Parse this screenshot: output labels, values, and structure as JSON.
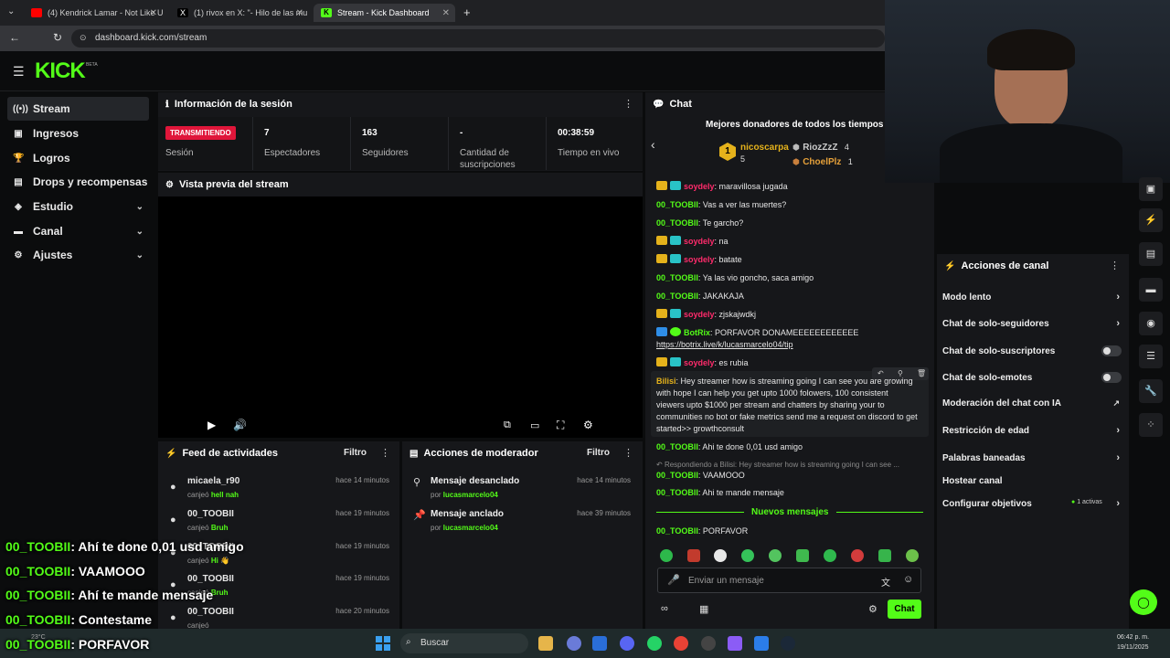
{
  "browser": {
    "tabs": [
      {
        "title": "(4) Kendrick Lamar - Not Like U",
        "active": false
      },
      {
        "title": "(1) rivox en X: \"- Hilo de las mu",
        "active": false
      },
      {
        "title": "Stream - Kick Dashboard",
        "active": true
      }
    ],
    "new_tab_icon": "plus-icon",
    "url": "dashboard.kick.com/stream"
  },
  "kick": {
    "logo": "KICK",
    "beta": "BETA"
  },
  "sidebar": {
    "items": [
      {
        "label": "Stream",
        "icon": "radio-icon"
      },
      {
        "label": "Ingresos",
        "icon": "money-icon"
      },
      {
        "label": "Logros",
        "icon": "trophy-icon"
      },
      {
        "label": "Drops y recompensas",
        "icon": "gift-icon"
      },
      {
        "label": "Estudio",
        "icon": "grid-icon"
      },
      {
        "label": "Canal",
        "icon": "channel-icon"
      },
      {
        "label": "Ajustes",
        "icon": "gear-icon"
      }
    ]
  },
  "session": {
    "title": "Información de la sesión",
    "status": "TRANSMITIENDO",
    "status_label": "Sesión",
    "stats": [
      {
        "value": "7",
        "label": "Espectadores"
      },
      {
        "value": "163",
        "label": "Seguidores"
      },
      {
        "value": "-",
        "label": "Cantidad de suscripciones"
      },
      {
        "value": "00:38:59",
        "label": "Tiempo en vivo"
      }
    ]
  },
  "preview": {
    "title": "Vista previa del stream"
  },
  "activity": {
    "title": "Feed de actividades",
    "filter": "Filtro",
    "rows": [
      {
        "name": "micaela_r90",
        "action": "canjeó",
        "reward": "hell nah",
        "time": "hace 14 minutos"
      },
      {
        "name": "00_TOOBII",
        "action": "canjeó",
        "reward": "Bruh",
        "time": "hace 19 minutos"
      },
      {
        "name": "00_TOOBII",
        "action": "canjeó",
        "reward": "Hi 👋",
        "time": "hace 19 minutos"
      },
      {
        "name": "00_TOOBII",
        "action": "canjeó",
        "reward": "Bruh",
        "time": "hace 19 minutos"
      },
      {
        "name": "00_TOOBII",
        "action": "canjeó",
        "reward": "",
        "time": "hace 20 minutos"
      }
    ]
  },
  "moderator": {
    "title": "Acciones de moderador",
    "filter": "Filtro",
    "rows": [
      {
        "title": "Mensaje desanclado",
        "by": "por",
        "user": "lucasmarcelo04",
        "time": "hace 14 minutos"
      },
      {
        "title": "Mensaje anclado",
        "by": "por",
        "user": "lucasmarcelo04",
        "time": "hace 39 minutos"
      }
    ]
  },
  "chat": {
    "title": "Chat",
    "donors_title": "Mejores donadores de todos los tiempos",
    "donors": [
      {
        "rank": "1",
        "name": "nicoscarpa",
        "amount": "5"
      },
      {
        "rank": "",
        "name": "RiozZzZ",
        "amount": "4"
      },
      {
        "rank": "",
        "name": "ChoelPlz",
        "amount": "1"
      }
    ],
    "messages": [
      {
        "user": "soydely",
        "text": "maravillosa jugada"
      },
      {
        "user": "00_TOOBII",
        "text": "Vas a ver las muertes?"
      },
      {
        "user": "00_TOOBII",
        "text": "Te garcho?"
      },
      {
        "user": "soydely",
        "text": "na"
      },
      {
        "user": "soydely",
        "text": "batate"
      },
      {
        "user": "00_TOOBII",
        "text": "Ya las vio goncho, saca amigo"
      },
      {
        "user": "00_TOOBII",
        "text": "JAKAKAJA"
      },
      {
        "user": "soydely",
        "text": "zjskajwdkj"
      },
      {
        "user": "BotRix",
        "text": "PORFAVOR DONAMEEEEEEEEEEEE",
        "link": "https://botrix.live/k/lucasmarcelo04/tip"
      },
      {
        "user": "soydely",
        "text": "es rubia"
      },
      {
        "user": "Bilisi",
        "text": "Hey streamer how is streaming going I can see you are growing with hope I can help you get upto 1000 folowers, 100 consistent viewers upto $1000 per stream and chatters by sharing your to communities no bot or fake metrics send me a request on discord to get started>> growthconsult"
      },
      {
        "user": "00_TOOBII",
        "text": "Ahi te done 0,01 usd amigo"
      },
      {
        "user": "00_TOOBII",
        "text": "VAAMOOO",
        "reply": "Respondiendo a Bilisi: Hey streamer how is streaming going I can see ..."
      },
      {
        "user": "00_TOOBII",
        "text": "Ahi te mande mensaje"
      }
    ],
    "new_messages": "Nuevos mensajes",
    "last_message": {
      "user": "00_TOOBII",
      "text": "PORFAVOR"
    },
    "input_placeholder": "Enviar un mensaje",
    "send_button": "Chat"
  },
  "channel_actions": {
    "title": "Acciones de canal",
    "items": [
      {
        "label": "Modo lento",
        "control": "chevron"
      },
      {
        "label": "Chat de solo-seguidores",
        "control": "chevron"
      },
      {
        "label": "Chat de solo-suscriptores",
        "control": "toggle"
      },
      {
        "label": "Chat de solo-emotes",
        "control": "toggle"
      },
      {
        "label": "Moderación del chat con IA",
        "control": "external"
      },
      {
        "label": "Restricción de edad",
        "control": "chevron"
      },
      {
        "label": "Palabras baneadas",
        "control": "chevron"
      },
      {
        "label": "Hostear canal",
        "control": "none"
      },
      {
        "label": "Configurar objetivos",
        "control": "chevron",
        "badge": "1 activas"
      }
    ]
  },
  "overlay_messages": [
    {
      "user": "00_TOOBII",
      "text": ": Ahí te done 0,01 usd amigo"
    },
    {
      "user": "00_TOOBII",
      "text": ": VAAMOOO"
    },
    {
      "user": "00_TOOBII",
      "text": ": Ahí te mande mensaje"
    },
    {
      "user": "00_TOOBII",
      "text": ": Contestame"
    },
    {
      "user": "00_TOOBII",
      "text": ": PORFAVOR"
    }
  ],
  "taskbar": {
    "search": "Buscar",
    "time": "06:42 p. m.",
    "date": "19/11/2025",
    "weather": "23°C"
  },
  "colors": {
    "accent": "#53fc18",
    "live": "#e0163a",
    "user_red": "#ff2b6b"
  }
}
